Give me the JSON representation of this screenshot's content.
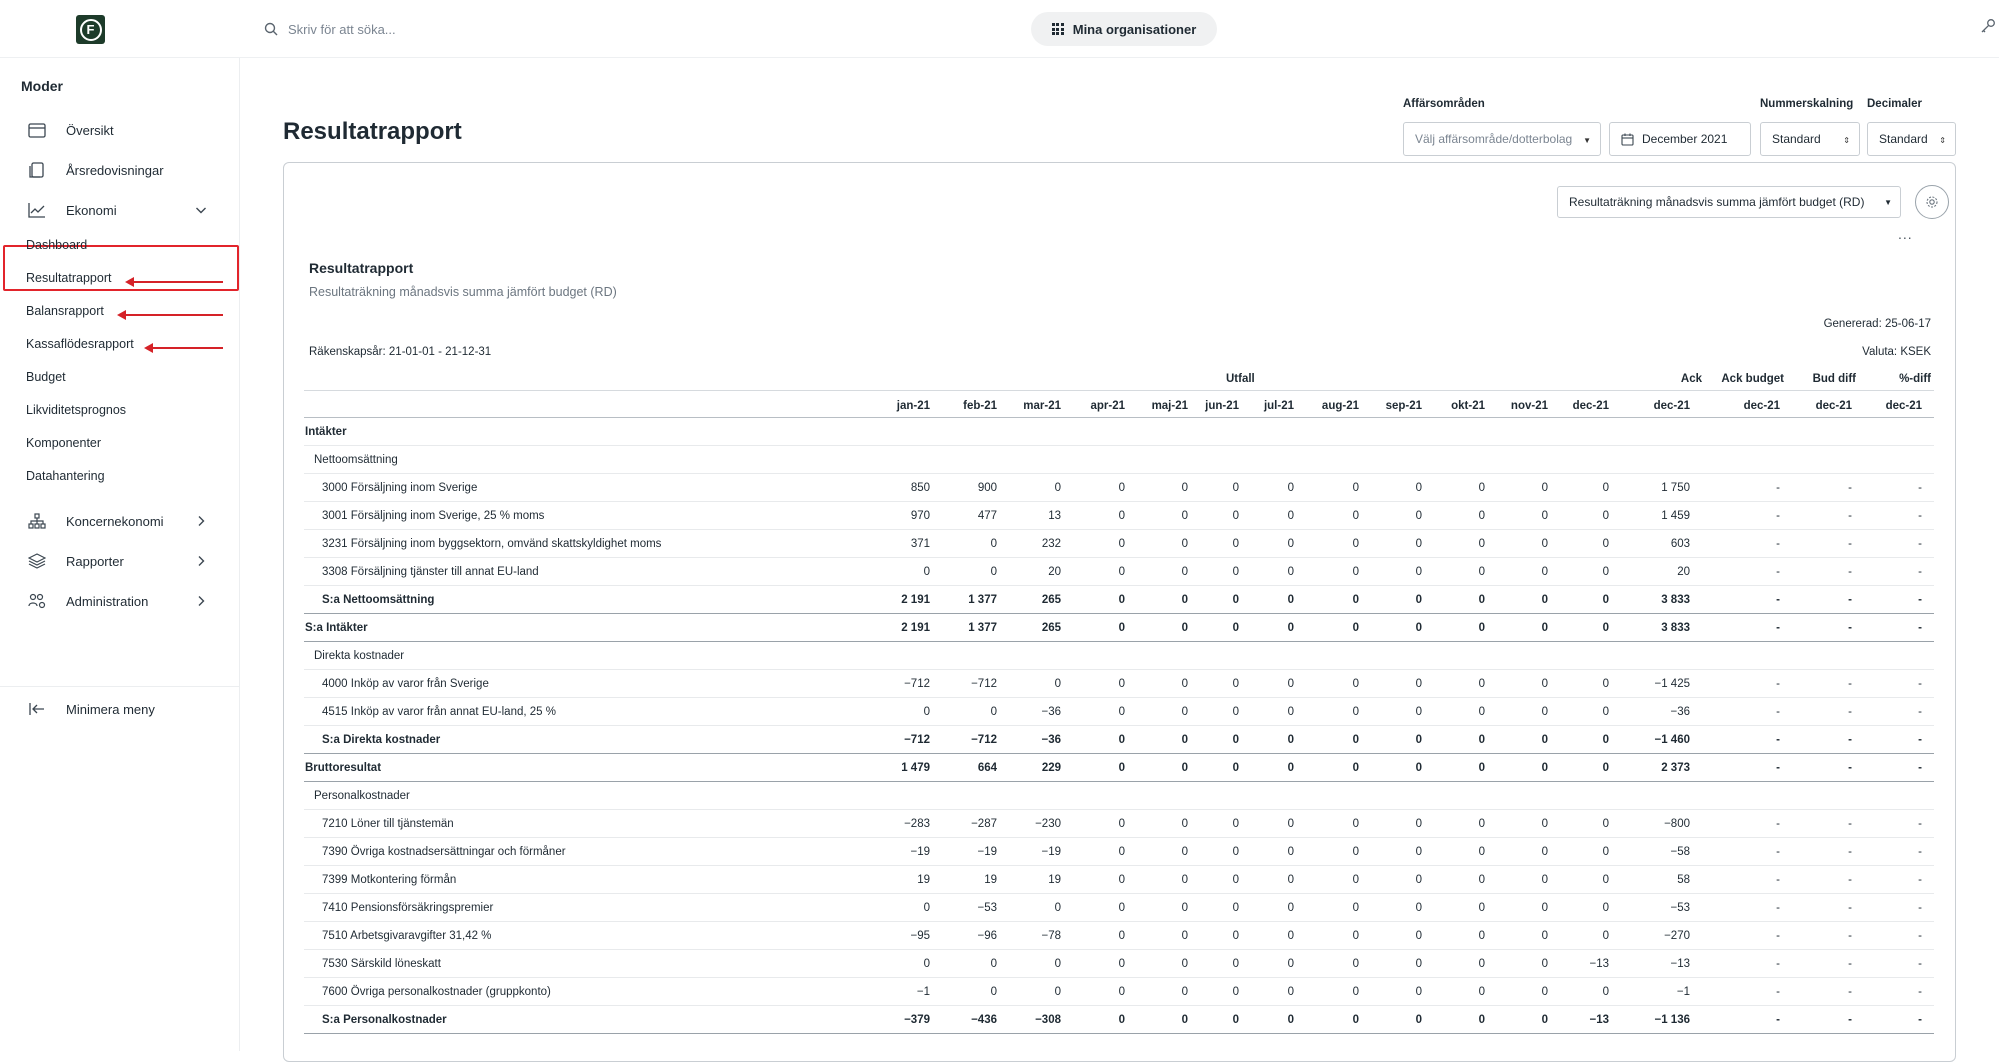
{
  "topbar": {
    "logo_letter": "F",
    "search_placeholder": "Skriv för att söka...",
    "org_button": "Mina organisationer"
  },
  "sidebar": {
    "title": "Moder",
    "items": [
      {
        "label": "Översikt",
        "icon": "calendar-icon"
      },
      {
        "label": "Årsredovisningar",
        "icon": "document-icon"
      },
      {
        "label": "Ekonomi",
        "icon": "chart-icon"
      }
    ],
    "sub_items": [
      "Dashboard",
      "Resultatrapport",
      "Balansrapport",
      "Kassaflödesrapport",
      "Budget",
      "Likviditetsprognos",
      "Komponenter",
      "Datahantering"
    ],
    "groups": [
      {
        "label": "Koncernekonomi",
        "icon": "org-tree-icon"
      },
      {
        "label": "Rapporter",
        "icon": "layers-icon"
      },
      {
        "label": "Administration",
        "icon": "users-gear-icon"
      }
    ],
    "minimize": "Minimera meny",
    "highlight_color": "#e2242b"
  },
  "main": {
    "title": "Resultatrapport",
    "filters": {
      "area_label": "Affärsområden",
      "area_placeholder": "Välj affärsområde/dotterbolag",
      "date_value": "December 2021",
      "scale_label": "Nummerskalning",
      "scale_value": "Standard",
      "decimals_label": "Decimaler",
      "decimals_value": "Standard"
    },
    "report_select": "Resultaträkning månadsvis summa jämfört budget (RD)",
    "more": "...",
    "report": {
      "title": "Resultatrapport",
      "subtitle": "Resultaträkning månadsvis summa jämfört budget (RD)",
      "generated": "Genererad:  25-06-17",
      "currency": "Valuta:  KSEK",
      "fiscal_year": "Räkenskapsår:  21-01-01 - 21-12-31"
    },
    "table": {
      "group_headers": {
        "utfall": "Utfall",
        "ack": "Ack",
        "ack_budget": "Ack budget",
        "bud_diff": "Bud diff",
        "pct_diff": "%-diff"
      },
      "columns": [
        "jan-21",
        "feb-21",
        "mar-21",
        "apr-21",
        "maj-21",
        "jun-21",
        "jul-21",
        "aug-21",
        "sep-21",
        "okt-21",
        "nov-21",
        "dec-21",
        "dec-21",
        "dec-21",
        "dec-21",
        "dec-21"
      ],
      "rows": [
        {
          "label": "Intäkter",
          "type": "section",
          "values": []
        },
        {
          "label": "Nettoomsättning",
          "type": "subsection",
          "values": []
        },
        {
          "label": "3000 Försäljning inom Sverige",
          "type": "account",
          "values": [
            "850",
            "900",
            "0",
            "0",
            "0",
            "0",
            "0",
            "0",
            "0",
            "0",
            "0",
            "0",
            "1 750",
            "-",
            "-",
            "-"
          ]
        },
        {
          "label": "3001 Försäljning inom Sverige, 25 % moms",
          "type": "account",
          "values": [
            "970",
            "477",
            "13",
            "0",
            "0",
            "0",
            "0",
            "0",
            "0",
            "0",
            "0",
            "0",
            "1 459",
            "-",
            "-",
            "-"
          ]
        },
        {
          "label": "3231 Försäljning inom byggsektorn, omvänd skattskyldighet moms",
          "type": "account",
          "values": [
            "371",
            "0",
            "232",
            "0",
            "0",
            "0",
            "0",
            "0",
            "0",
            "0",
            "0",
            "0",
            "603",
            "-",
            "-",
            "-"
          ]
        },
        {
          "label": "3308 Försäljning tjänster till annat EU-land",
          "type": "account",
          "values": [
            "0",
            "0",
            "20",
            "0",
            "0",
            "0",
            "0",
            "0",
            "0",
            "0",
            "0",
            "0",
            "20",
            "-",
            "-",
            "-"
          ]
        },
        {
          "label": "S:a Nettoomsättning",
          "type": "subtotal",
          "values": [
            "2 191",
            "1 377",
            "265",
            "0",
            "0",
            "0",
            "0",
            "0",
            "0",
            "0",
            "0",
            "0",
            "3 833",
            "-",
            "-",
            "-"
          ]
        },
        {
          "label": "S:a Intäkter",
          "type": "total",
          "values": [
            "2 191",
            "1 377",
            "265",
            "0",
            "0",
            "0",
            "0",
            "0",
            "0",
            "0",
            "0",
            "0",
            "3 833",
            "-",
            "-",
            "-"
          ]
        },
        {
          "label": "Direkta kostnader",
          "type": "subsection",
          "values": []
        },
        {
          "label": "4000 Inköp av varor från Sverige",
          "type": "account",
          "values": [
            "−712",
            "−712",
            "0",
            "0",
            "0",
            "0",
            "0",
            "0",
            "0",
            "0",
            "0",
            "0",
            "−1 425",
            "-",
            "-",
            "-"
          ]
        },
        {
          "label": "4515 Inköp av varor från annat EU-land, 25 %",
          "type": "account",
          "values": [
            "0",
            "0",
            "−36",
            "0",
            "0",
            "0",
            "0",
            "0",
            "0",
            "0",
            "0",
            "0",
            "−36",
            "-",
            "-",
            "-"
          ]
        },
        {
          "label": "S:a Direkta kostnader",
          "type": "subtotal",
          "values": [
            "−712",
            "−712",
            "−36",
            "0",
            "0",
            "0",
            "0",
            "0",
            "0",
            "0",
            "0",
            "0",
            "−1 460",
            "-",
            "-",
            "-"
          ]
        },
        {
          "label": "Bruttoresultat",
          "type": "total",
          "values": [
            "1 479",
            "664",
            "229",
            "0",
            "0",
            "0",
            "0",
            "0",
            "0",
            "0",
            "0",
            "0",
            "2 373",
            "-",
            "-",
            "-"
          ]
        },
        {
          "label": "Personalkostnader",
          "type": "subsection",
          "values": []
        },
        {
          "label": "7210 Löner till tjänstemän",
          "type": "account",
          "values": [
            "−283",
            "−287",
            "−230",
            "0",
            "0",
            "0",
            "0",
            "0",
            "0",
            "0",
            "0",
            "0",
            "−800",
            "-",
            "-",
            "-"
          ]
        },
        {
          "label": "7390 Övriga kostnadsersättningar och förmåner",
          "type": "account",
          "values": [
            "−19",
            "−19",
            "−19",
            "0",
            "0",
            "0",
            "0",
            "0",
            "0",
            "0",
            "0",
            "0",
            "−58",
            "-",
            "-",
            "-"
          ]
        },
        {
          "label": "7399 Motkontering förmån",
          "type": "account",
          "values": [
            "19",
            "19",
            "19",
            "0",
            "0",
            "0",
            "0",
            "0",
            "0",
            "0",
            "0",
            "0",
            "58",
            "-",
            "-",
            "-"
          ]
        },
        {
          "label": "7410 Pensionsförsäkringspremier",
          "type": "account",
          "values": [
            "0",
            "−53",
            "0",
            "0",
            "0",
            "0",
            "0",
            "0",
            "0",
            "0",
            "0",
            "0",
            "−53",
            "-",
            "-",
            "-"
          ]
        },
        {
          "label": "7510 Arbetsgivaravgifter 31,42 %",
          "type": "account",
          "values": [
            "−95",
            "−96",
            "−78",
            "0",
            "0",
            "0",
            "0",
            "0",
            "0",
            "0",
            "0",
            "0",
            "−270",
            "-",
            "-",
            "-"
          ]
        },
        {
          "label": "7530 Särskild löneskatt",
          "type": "account",
          "values": [
            "0",
            "0",
            "0",
            "0",
            "0",
            "0",
            "0",
            "0",
            "0",
            "0",
            "0",
            "−13",
            "−13",
            "-",
            "-",
            "-"
          ]
        },
        {
          "label": "7600 Övriga personalkostnader (gruppkonto)",
          "type": "account",
          "values": [
            "−1",
            "0",
            "0",
            "0",
            "0",
            "0",
            "0",
            "0",
            "0",
            "0",
            "0",
            "0",
            "−1",
            "-",
            "-",
            "-"
          ]
        },
        {
          "label": "S:a Personalkostnader",
          "type": "subtotal",
          "values": [
            "−379",
            "−436",
            "−308",
            "0",
            "0",
            "0",
            "0",
            "0",
            "0",
            "0",
            "0",
            "−13",
            "−1 136",
            "-",
            "-",
            "-"
          ]
        }
      ]
    }
  }
}
